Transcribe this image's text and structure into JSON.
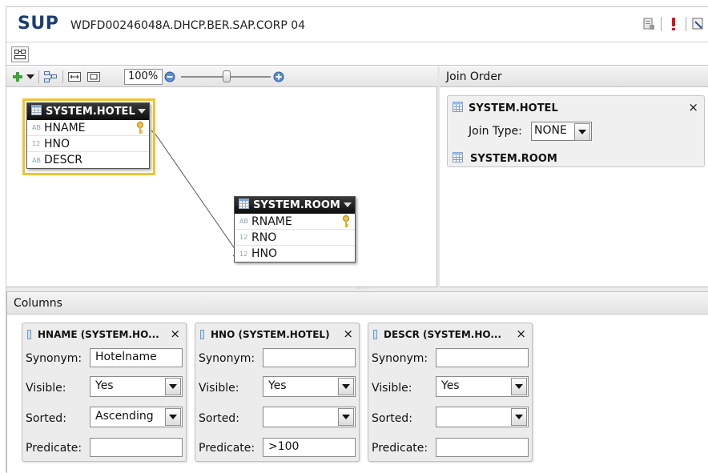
{
  "header": {
    "system_id": "SUP",
    "host": "WDFD00246048A.DHCP.BER.SAP.CORP 04"
  },
  "toolbar": {
    "zoom": "100%"
  },
  "diagram": {
    "tables": [
      {
        "name": "SYSTEM.HOTEL",
        "selected": true,
        "columns": [
          {
            "type": "AB",
            "name": "HNAME",
            "key": true
          },
          {
            "type": "12",
            "name": "HNO",
            "key": false
          },
          {
            "type": "AB",
            "name": "DESCR",
            "key": false
          }
        ]
      },
      {
        "name": "SYSTEM.ROOM",
        "selected": false,
        "columns": [
          {
            "type": "AB",
            "name": "RNAME",
            "key": true
          },
          {
            "type": "12",
            "name": "RNO",
            "key": false
          },
          {
            "type": "12",
            "name": "HNO",
            "key": false
          }
        ]
      }
    ]
  },
  "join_order": {
    "title": "Join Order",
    "first_table": "SYSTEM.HOTEL",
    "close": "×",
    "join_type_label": "Join Type:",
    "join_type_value": "NONE",
    "second_table": "SYSTEM.ROOM"
  },
  "columns_pane": {
    "title": "Columns",
    "labels": {
      "synonym": "Synonym:",
      "visible": "Visible:",
      "sorted": "Sorted:",
      "predicate": "Predicate:"
    },
    "cards": [
      {
        "title": "HNAME (SYSTEM.HO...",
        "close": "×",
        "synonym": "Hotelname",
        "visible": "Yes",
        "sorted": "Ascending",
        "predicate": ""
      },
      {
        "title": "HNO (SYSTEM.HOTEL)",
        "close": "×",
        "synonym": "",
        "visible": "Yes",
        "sorted": "",
        "predicate": ">100"
      },
      {
        "title": "DESCR (SYSTEM.HO...",
        "close": "×",
        "synonym": "",
        "visible": "Yes",
        "sorted": "",
        "predicate": ""
      }
    ]
  },
  "colors": {
    "brand": "#1b3d72",
    "selection": "#f2c232",
    "header_dark": "#0c0c0c"
  }
}
